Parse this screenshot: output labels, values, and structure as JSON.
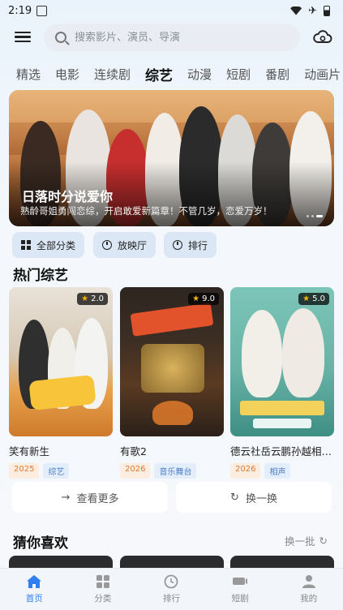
{
  "status": {
    "time": "2:19"
  },
  "search": {
    "placeholder": "搜索影片、演员、导演"
  },
  "tabs": [
    "精选",
    "电影",
    "连续剧",
    "综艺",
    "动漫",
    "短剧",
    "番剧",
    "动画片"
  ],
  "active_tab": 3,
  "banner": {
    "title": "日落时分说爱你",
    "subtitle": "熟龄哥姐勇闯恋综，开启敢爱新篇章！不管几岁，恋爱万岁！"
  },
  "quick_actions": [
    {
      "label": "全部分类",
      "icon": "grid-icon"
    },
    {
      "label": "放映厅",
      "icon": "clock-icon"
    },
    {
      "label": "排行",
      "icon": "clock-icon"
    }
  ],
  "hot_section": {
    "title": "热门综艺"
  },
  "hot_items": [
    {
      "title": "笑有新生",
      "rating": "2.0",
      "year": "2025",
      "category": "综艺",
      "accent": "#d9823a"
    },
    {
      "title": "有歌2",
      "rating": "9.0",
      "year": "2026",
      "category": "音乐舞台",
      "accent": "#2c2623"
    },
    {
      "title": "德云社岳云鹏孙越相…",
      "rating": "5.0",
      "year": "2026",
      "category": "相声",
      "accent": "#6bb5a8"
    }
  ],
  "buttons": {
    "more": "查看更多",
    "swap": "换一换"
  },
  "guess_section": {
    "title": "猜你喜欢",
    "refresh": "换一批"
  },
  "bottom_nav": [
    {
      "label": "首页",
      "icon": "home-icon"
    },
    {
      "label": "分类",
      "icon": "category-icon"
    },
    {
      "label": "排行",
      "icon": "ranking-icon"
    },
    {
      "label": "短剧",
      "icon": "short-drama-icon"
    },
    {
      "label": "我的",
      "icon": "profile-icon"
    }
  ],
  "colors": {
    "accent": "#2f7ff0",
    "quick_bg": "#dbe7f4"
  }
}
